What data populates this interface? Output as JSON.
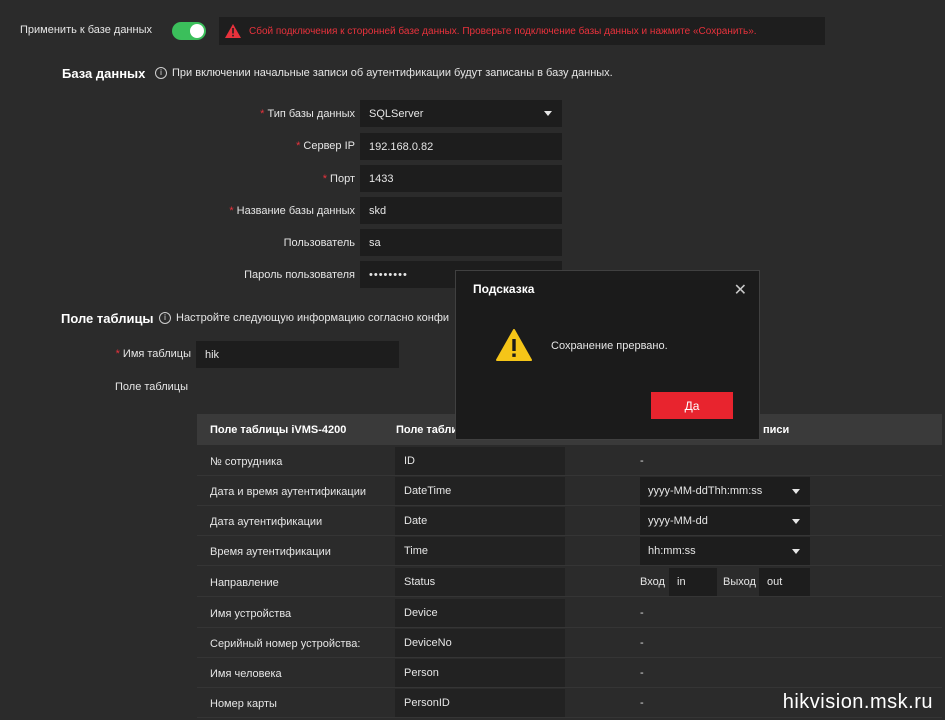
{
  "top": {
    "apply_label": "Применить к базе данных",
    "toggle_on": true,
    "alert_text": "Сбой подключения к сторонней базе данных. Проверьте подключение базы данных и нажмите «Сохранить»."
  },
  "database": {
    "title": "База данных",
    "hint": "При включении начальные записи об аутентификации будут записаны в базу данных.",
    "fields": [
      {
        "label": "Тип базы данных",
        "required": "*",
        "value": "SQLServer"
      },
      {
        "label": "Сервер IP",
        "required": "*",
        "value": "192.168.0.82"
      },
      {
        "label": "Порт",
        "required": "*",
        "value": "1433"
      },
      {
        "label": "Название базы данных",
        "required": "*",
        "value": "skd"
      },
      {
        "label": "Пользователь",
        "value": "sa"
      },
      {
        "label": "Пароль пользователя",
        "value": "••••••••"
      }
    ]
  },
  "table_section": {
    "title": "Поле таблицы",
    "hint": "Настройте следующую информацию согласно конфи",
    "table_name_label": "Имя таблицы",
    "table_name_required": "*",
    "table_name_value": "hik",
    "fields_label": "Поле таблицы"
  },
  "table": {
    "headers": [
      "Поле таблицы iVMS-4200",
      "Поле табли",
      "писи"
    ],
    "rows": [
      {
        "name": "№ сотрудника",
        "field": "ID",
        "fmt": "-"
      },
      {
        "name": "Дата и время аутентификации",
        "field": "DateTime",
        "fmt": "yyyy-MM-ddThh:mm:ss"
      },
      {
        "name": "Дата аутентификации",
        "field": "Date",
        "fmt": "yyyy-MM-dd"
      },
      {
        "name": "Время аутентификации",
        "field": "Time",
        "fmt": "hh:mm:ss"
      },
      {
        "name": "Направление",
        "field": "Status",
        "in_label": "Вход",
        "in_value": "in",
        "out_label": "Выход",
        "out_value": "out"
      },
      {
        "name": "Имя устройства",
        "field": "Device",
        "fmt": "-"
      },
      {
        "name": "Серийный номер устройства:",
        "field": "DeviceNo",
        "fmt": "-"
      },
      {
        "name": "Имя человека",
        "field": "Person",
        "fmt": "-"
      },
      {
        "name": "Номер карты",
        "field": "PersonID",
        "fmt": "-"
      }
    ]
  },
  "modal": {
    "title": "Подсказка",
    "message": "Сохранение прервано.",
    "ok_label": "Да",
    "close_icon": "close-icon",
    "warning_icon": "warning-icon"
  },
  "watermark": "hikvision.msk.ru",
  "colors": {
    "accent_red": "#e8242e",
    "toggle_green": "#3bbf5b",
    "background": "#2b2b2b"
  }
}
